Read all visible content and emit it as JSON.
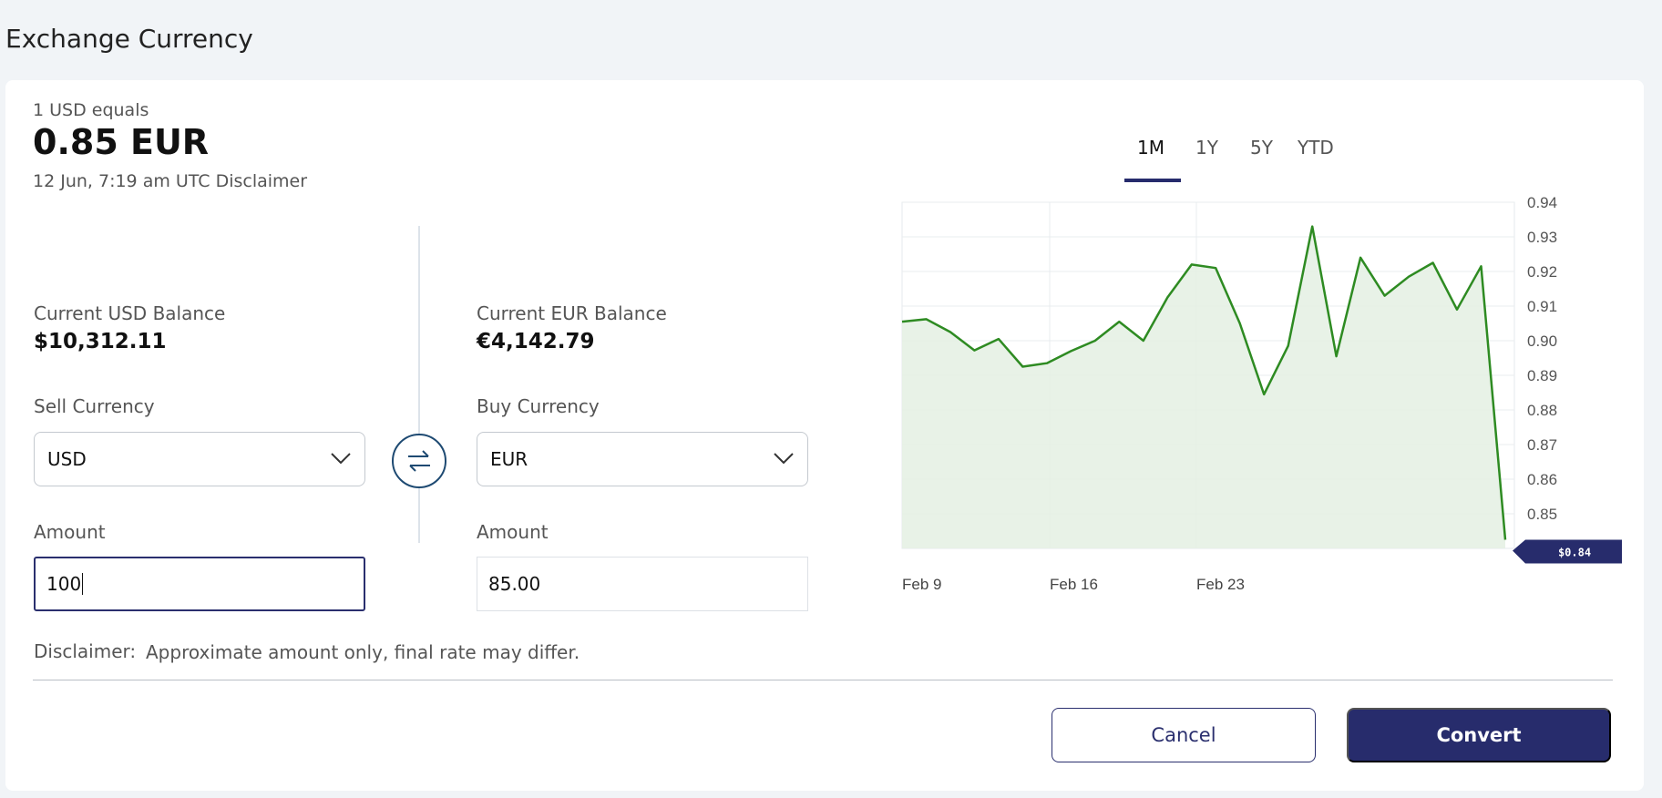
{
  "page": {
    "title": "Exchange Currency"
  },
  "rate": {
    "caption": "1 USD equals",
    "value": "0.85 EUR",
    "meta": "12 Jun, 7:19 am UTC Disclaimer"
  },
  "sell": {
    "balance_label": "Current USD Balance",
    "balance_value": "$10,312.11",
    "currency_label": "Sell Currency",
    "currency_value": "USD",
    "amount_label": "Amount",
    "amount_value": "100"
  },
  "buy": {
    "balance_label": "Current EUR Balance",
    "balance_value": "€4,142.79",
    "currency_label": "Buy Currency",
    "currency_value": "EUR",
    "amount_label": "Amount",
    "amount_value": "85.00"
  },
  "disclaimer": {
    "label": "Disclaimer:",
    "text": "Approximate amount only, final rate may differ."
  },
  "actions": {
    "cancel_label": "Cancel",
    "convert_label": "Convert"
  },
  "chart_tabs": [
    {
      "label": "1M",
      "active": true
    },
    {
      "label": "1Y",
      "active": false
    },
    {
      "label": "5Y",
      "active": false
    },
    {
      "label": "YTD",
      "active": false
    }
  ],
  "colors": {
    "line": "#2e8b22",
    "fill": "#e6f1e4",
    "accent": "#272c6c",
    "current_marker": "#272c6c"
  },
  "chart_data": {
    "type": "area",
    "ylim": [
      0.84,
      0.94
    ],
    "yticks": [
      0.85,
      0.86,
      0.87,
      0.88,
      0.89,
      0.9,
      0.91,
      0.92,
      0.93,
      0.94
    ],
    "xtick_labels": [
      "Feb 9",
      "Feb 16",
      "Feb 23"
    ],
    "current_value_label": "$0.84",
    "grid": true,
    "series": [
      {
        "values": [
          0.9055,
          0.9062,
          0.9025,
          0.8972,
          0.9005,
          0.8925,
          0.8935,
          0.897,
          0.9,
          0.9055,
          0.9,
          0.9125,
          0.922,
          0.921,
          0.905,
          0.8845,
          0.8985,
          0.933,
          0.8955,
          0.924,
          0.913,
          0.9185,
          0.9225,
          0.909,
          0.9215,
          0.8425
        ]
      }
    ]
  }
}
